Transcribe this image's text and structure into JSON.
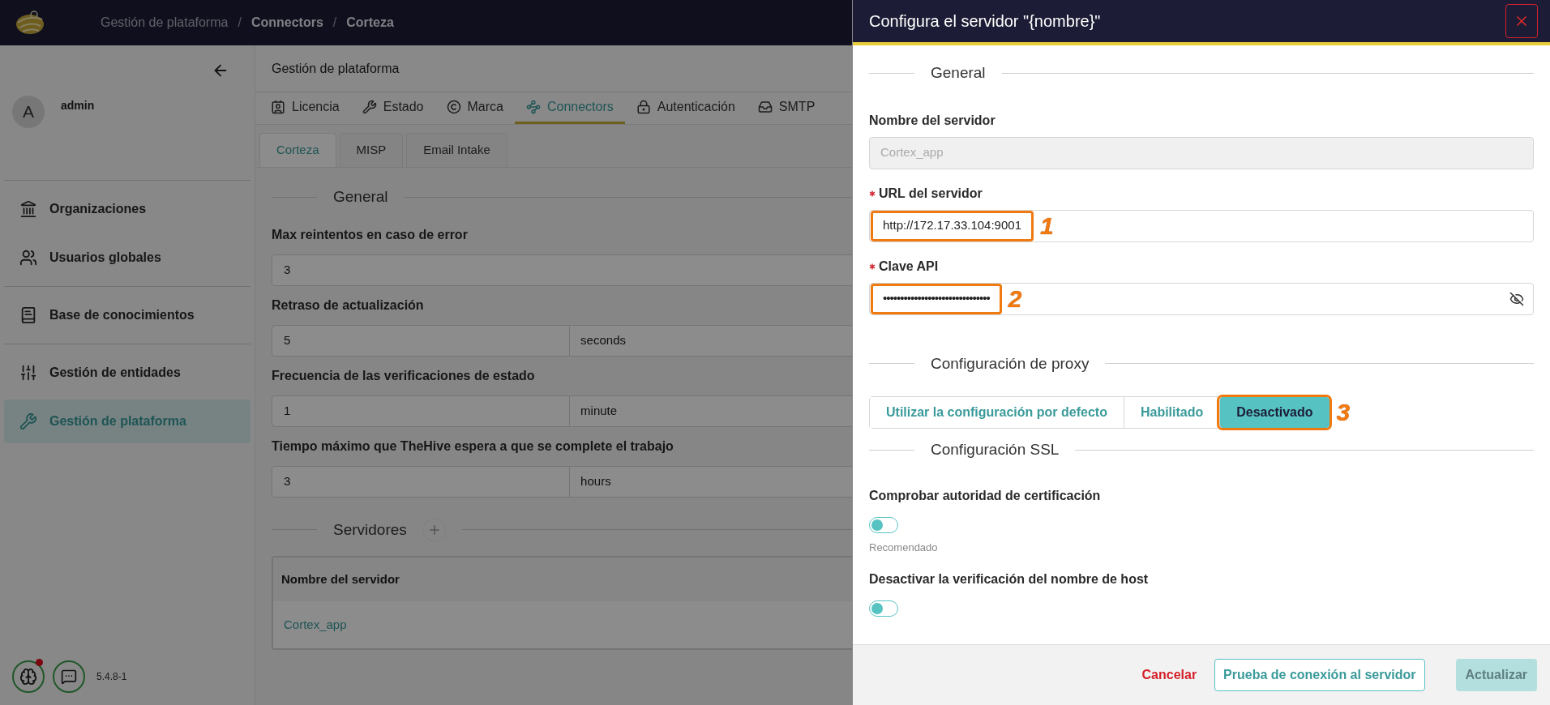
{
  "header": {
    "breadcrumbs": [
      {
        "kind": "link",
        "label": "Gestión de plataforma"
      },
      {
        "kind": "separator",
        "label": "/"
      },
      {
        "kind": "link",
        "label": "Connectors"
      },
      {
        "kind": "separator",
        "label": "/"
      },
      {
        "kind": "current",
        "label": "Corteza"
      }
    ]
  },
  "sidebar": {
    "user": {
      "initial": "A",
      "name": "admin"
    },
    "groups": [
      [
        {
          "label": "Organizaciones",
          "selected": false
        },
        {
          "label": "Usuarios globales",
          "selected": false
        }
      ],
      [
        {
          "label": "Base de conocimientos",
          "selected": false
        }
      ],
      [
        {
          "label": "Gestión de entidades",
          "selected": false
        },
        {
          "label": "Gestión de plataforma",
          "selected": true
        }
      ]
    ],
    "footer": {
      "notification": true,
      "version": "5.4.8-1"
    }
  },
  "main": {
    "title": "Gestión de plataforma",
    "tabs": [
      {
        "label": "Licencia",
        "selected": false
      },
      {
        "label": "Estado",
        "selected": false
      },
      {
        "label": "Marca",
        "selected": false
      },
      {
        "label": "Connectors",
        "selected": true
      },
      {
        "label": "Autenticación",
        "selected": false
      },
      {
        "label": "SMTP",
        "selected": false
      }
    ],
    "subtabs": [
      {
        "label": "Corteza",
        "selected": true
      },
      {
        "label": "MISP",
        "selected": false
      },
      {
        "label": "Email Intake",
        "selected": false
      }
    ],
    "general": {
      "heading": "General",
      "fields": [
        {
          "label": "Max reintentos en caso de error",
          "value": "3"
        },
        {
          "label": "Retraso de actualización",
          "value": "5",
          "unit": "seconds"
        },
        {
          "label": "Frecuencia de las verificaciones de estado",
          "value": "1",
          "unit": "minute"
        },
        {
          "label": "Tiempo máximo que TheHive espera a que se complete el trabajo",
          "value": "3",
          "unit": "hours"
        }
      ]
    },
    "servers": {
      "heading": "Servidores",
      "table": {
        "columns": [
          "Nombre del servidor"
        ],
        "rows": [
          [
            "Cortex_app"
          ]
        ]
      }
    }
  },
  "drawer": {
    "title": "Configura el servidor \"{nombre}\"",
    "general": {
      "heading": "General",
      "fields": [
        {
          "kind": "text",
          "label": "Nombre del servidor",
          "value": "Cortex_app",
          "required": false,
          "disabled": true
        },
        {
          "kind": "text",
          "label": "URL del servidor",
          "value": "http://172.17.33.104:9001",
          "required": true,
          "disabled": false,
          "callout": "1"
        },
        {
          "kind": "password",
          "label": "Clave API",
          "value": "•••••••••••••••••••••••••••••••",
          "required": true,
          "disabled": false,
          "callout": "2"
        }
      ]
    },
    "proxy": {
      "heading": "Configuración de proxy",
      "callout": "3",
      "options": [
        {
          "label": "Utilizar la configuración por defecto",
          "selected": false
        },
        {
          "label": "Habilitado",
          "selected": false
        },
        {
          "label": "Desactivado",
          "selected": true
        }
      ]
    },
    "ssl": {
      "heading": "Configuración SSL",
      "toggles": [
        {
          "label": "Comprobar autoridad de certificación",
          "on": false,
          "hint": "Recomendado"
        },
        {
          "label": "Desactivar la verificación del nombre de host",
          "on": false
        }
      ]
    },
    "footer": {
      "buttons": [
        {
          "kind": "cancel",
          "label": "Cancelar"
        },
        {
          "kind": "outline",
          "label": "Prueba de conexión al servidor"
        },
        {
          "kind": "primary",
          "label": "Actualizar",
          "disabled": true
        }
      ]
    }
  }
}
